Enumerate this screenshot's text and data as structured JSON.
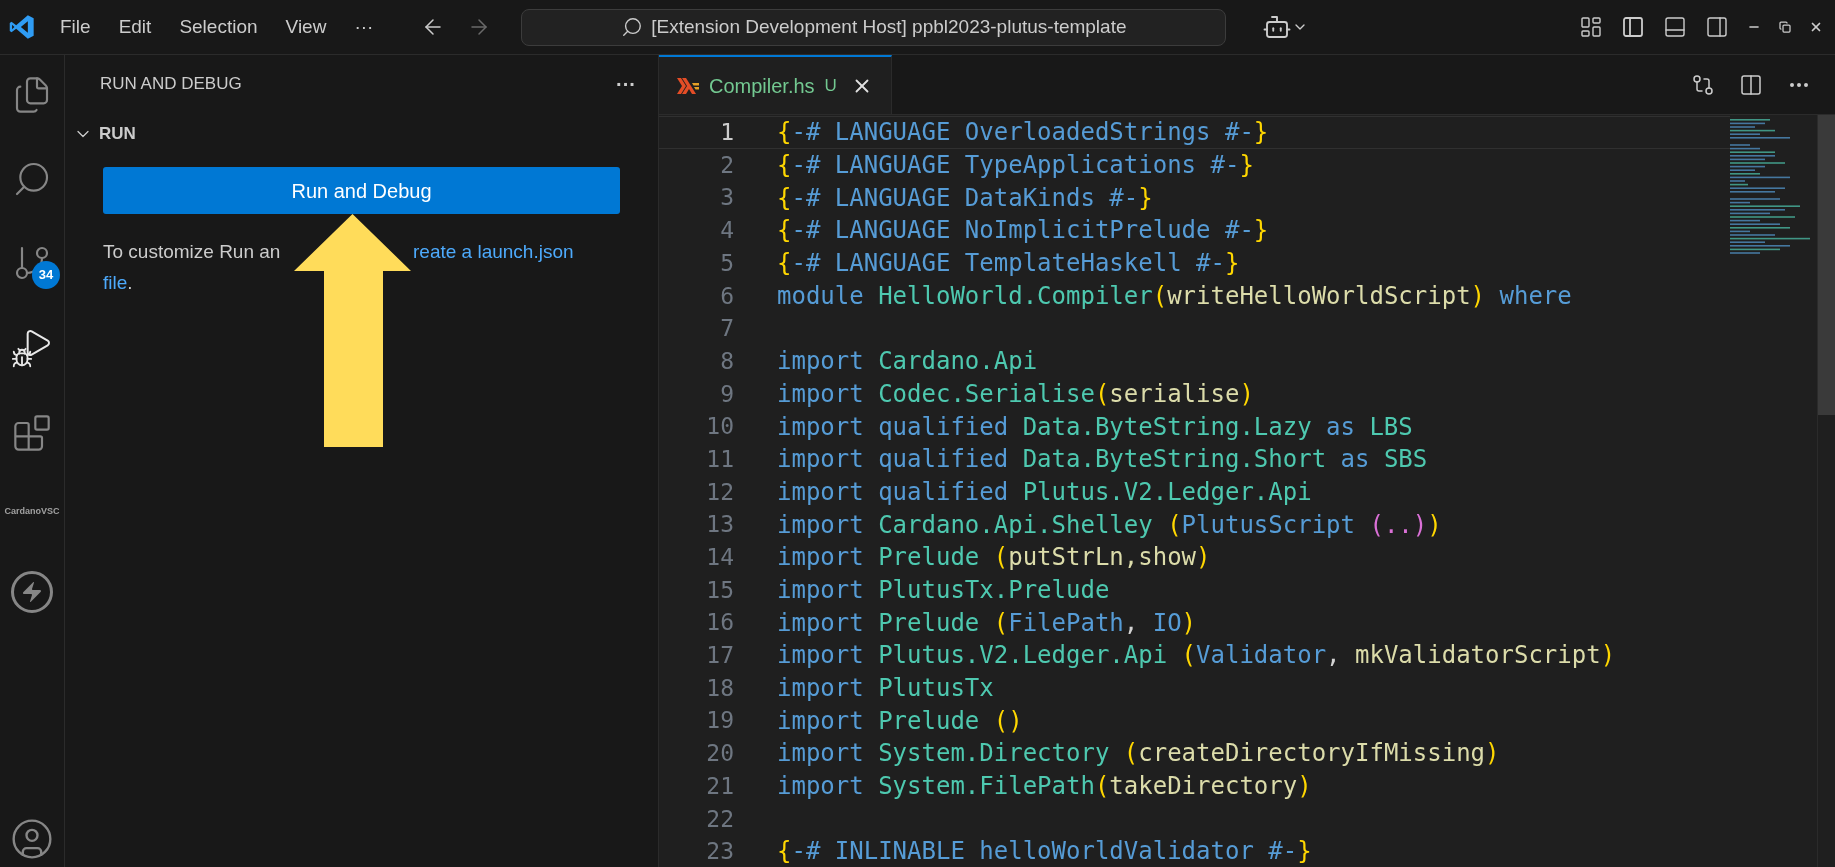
{
  "title_bar": {
    "menu": [
      "File",
      "Edit",
      "Selection",
      "View",
      "···"
    ],
    "command_center": "[Extension Development Host] ppbl2023-plutus-template"
  },
  "activity_bar": [
    {
      "kind": "files",
      "selected": false
    },
    {
      "kind": "search",
      "selected": false
    },
    {
      "kind": "source-control",
      "selected": false,
      "badge": "34"
    },
    {
      "kind": "run-debug",
      "selected": true
    },
    {
      "kind": "extensions",
      "selected": false
    },
    {
      "kind": "text",
      "selected": false,
      "label": "CardanoVSC"
    },
    {
      "kind": "lightning",
      "selected": false
    },
    {
      "kind": "account",
      "selected": false
    }
  ],
  "sidebar": {
    "title": "RUN AND DEBUG",
    "more": "···",
    "section": {
      "title": "RUN",
      "expanded": true
    },
    "button": "Run and Debug",
    "text": "To customize Run an",
    "links": [
      "reate a launch.json",
      "file"
    ],
    "text_end": "."
  },
  "editor": {
    "tabs": [
      {
        "label": "Compiler.hs",
        "status": "U",
        "selected": true
      }
    ],
    "lines": [
      {
        "number": "1",
        "current": true,
        "tokens": [
          {
            "text": "{",
            "kind": "paren"
          },
          {
            "text": "-# LANGUAGE OverloadedStrings #-",
            "kind": "kw"
          },
          {
            "text": "}",
            "kind": "paren"
          }
        ]
      },
      {
        "number": "2",
        "current": false,
        "tokens": [
          {
            "text": "{",
            "kind": "paren"
          },
          {
            "text": "-# LANGUAGE TypeApplications #-",
            "kind": "kw"
          },
          {
            "text": "}",
            "kind": "paren"
          }
        ]
      },
      {
        "number": "3",
        "current": false,
        "tokens": [
          {
            "text": "{",
            "kind": "paren"
          },
          {
            "text": "-# LANGUAGE DataKinds #-",
            "kind": "kw"
          },
          {
            "text": "}",
            "kind": "paren"
          }
        ]
      },
      {
        "number": "4",
        "current": false,
        "tokens": [
          {
            "text": "{",
            "kind": "paren"
          },
          {
            "text": "-# LANGUAGE NoImplicitPrelude #-",
            "kind": "kw"
          },
          {
            "text": "}",
            "kind": "paren"
          }
        ]
      },
      {
        "number": "5",
        "current": false,
        "tokens": [
          {
            "text": "{",
            "kind": "paren"
          },
          {
            "text": "-# LANGUAGE TemplateHaskell #-",
            "kind": "kw"
          },
          {
            "text": "}",
            "kind": "paren"
          }
        ]
      },
      {
        "number": "6",
        "current": false,
        "tokens": [
          {
            "text": "module ",
            "kind": "kw"
          },
          {
            "text": "HelloWorld.Compiler",
            "kind": "mod"
          },
          {
            "text": "(",
            "kind": "paren"
          },
          {
            "text": "writeHelloWorldScript",
            "kind": "fn"
          },
          {
            "text": ")",
            "kind": "paren"
          },
          {
            "text": " where",
            "kind": "kw"
          }
        ]
      },
      {
        "number": "7",
        "current": false
      },
      {
        "number": "8",
        "current": false,
        "tokens": [
          {
            "text": "import ",
            "kind": "kw"
          },
          {
            "text": "Cardano.Api",
            "kind": "mod"
          }
        ]
      },
      {
        "number": "9",
        "current": false,
        "tokens": [
          {
            "text": "import ",
            "kind": "kw"
          },
          {
            "text": "Codec.Serialise",
            "kind": "mod"
          },
          {
            "text": "(",
            "kind": "paren"
          },
          {
            "text": "serialise",
            "kind": "fn"
          },
          {
            "text": ")",
            "kind": "paren"
          }
        ]
      },
      {
        "number": "10",
        "current": false,
        "tokens": [
          {
            "text": "import qualified ",
            "kind": "kw"
          },
          {
            "text": "Data.ByteString.Lazy",
            "kind": "mod"
          },
          {
            "text": " as ",
            "kind": "kw"
          },
          {
            "text": "LBS",
            "kind": "mod"
          }
        ]
      },
      {
        "number": "11",
        "current": false,
        "tokens": [
          {
            "text": "import qualified ",
            "kind": "kw"
          },
          {
            "text": "Data.ByteString.Short",
            "kind": "mod"
          },
          {
            "text": " as ",
            "kind": "kw"
          },
          {
            "text": "SBS",
            "kind": "mod"
          }
        ]
      },
      {
        "number": "12",
        "current": false,
        "tokens": [
          {
            "text": "import qualified ",
            "kind": "kw"
          },
          {
            "text": "Plutus.V2.Ledger.Api",
            "kind": "mod"
          }
        ]
      },
      {
        "number": "13",
        "current": false,
        "tokens": [
          {
            "text": "import ",
            "kind": "kw"
          },
          {
            "text": "Cardano.Api.Shelley ",
            "kind": "mod"
          },
          {
            "text": "(",
            "kind": "paren"
          },
          {
            "text": "PlutusScript ",
            "kind": "kw"
          },
          {
            "text": "(..)",
            "kind": "pink"
          },
          {
            "text": ")",
            "kind": "paren"
          }
        ]
      },
      {
        "number": "14",
        "current": false,
        "tokens": [
          {
            "text": "import ",
            "kind": "kw"
          },
          {
            "text": "Prelude ",
            "kind": "mod"
          },
          {
            "text": "(",
            "kind": "paren"
          },
          {
            "text": "putStrLn,show",
            "kind": "fn"
          },
          {
            "text": ")",
            "kind": "paren"
          }
        ]
      },
      {
        "number": "15",
        "current": false,
        "tokens": [
          {
            "text": "import ",
            "kind": "kw"
          },
          {
            "text": "PlutusTx.Prelude",
            "kind": "mod"
          }
        ]
      },
      {
        "number": "16",
        "current": false,
        "tokens": [
          {
            "text": "import ",
            "kind": "kw"
          },
          {
            "text": "Prelude ",
            "kind": "mod"
          },
          {
            "text": "(",
            "kind": "paren"
          },
          {
            "text": "FilePath",
            "kind": "kw"
          },
          {
            "text": ", ",
            "kind": "plain"
          },
          {
            "text": "IO",
            "kind": "kw"
          },
          {
            "text": ")",
            "kind": "paren"
          }
        ]
      },
      {
        "number": "17",
        "current": false,
        "tokens": [
          {
            "text": "import ",
            "kind": "kw"
          },
          {
            "text": "Plutus.V2.Ledger.Api ",
            "kind": "mod"
          },
          {
            "text": "(",
            "kind": "paren"
          },
          {
            "text": "Validator",
            "kind": "kw"
          },
          {
            "text": ", ",
            "kind": "plain"
          },
          {
            "text": "mkValidatorScript",
            "kind": "fn"
          },
          {
            "text": ")",
            "kind": "paren"
          }
        ]
      },
      {
        "number": "18",
        "current": false,
        "tokens": [
          {
            "text": "import ",
            "kind": "kw"
          },
          {
            "text": "PlutusTx",
            "kind": "mod"
          }
        ]
      },
      {
        "number": "19",
        "current": false,
        "tokens": [
          {
            "text": "import ",
            "kind": "kw"
          },
          {
            "text": "Prelude ",
            "kind": "mod"
          },
          {
            "text": "()",
            "kind": "paren"
          }
        ]
      },
      {
        "number": "20",
        "current": false,
        "tokens": [
          {
            "text": "import ",
            "kind": "kw"
          },
          {
            "text": "System.Directory ",
            "kind": "mod"
          },
          {
            "text": "(",
            "kind": "paren"
          },
          {
            "text": "createDirectoryIfMissing",
            "kind": "fn"
          },
          {
            "text": ")",
            "kind": "paren"
          }
        ]
      },
      {
        "number": "21",
        "current": false,
        "tokens": [
          {
            "text": "import ",
            "kind": "kw"
          },
          {
            "text": "System.FilePath",
            "kind": "mod"
          },
          {
            "text": "(",
            "kind": "paren"
          },
          {
            "text": "takeDirectory",
            "kind": "fn"
          },
          {
            "text": ")",
            "kind": "paren"
          }
        ]
      },
      {
        "number": "22",
        "current": false
      },
      {
        "number": "23",
        "current": false,
        "tokens": [
          {
            "text": "{",
            "kind": "paren"
          },
          {
            "text": "-# INLINABLE helloWorldValidator #-",
            "kind": "kw"
          },
          {
            "text": "}",
            "kind": "paren"
          }
        ]
      }
    ]
  }
}
